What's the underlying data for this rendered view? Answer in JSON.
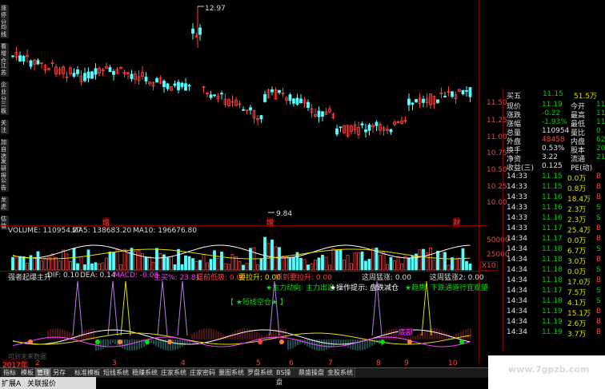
{
  "chart": {
    "price_high_label": "12.97",
    "price_low_label": "9.84",
    "price_axis": [
      "11.50",
      "11.25",
      "11.00",
      "10.75",
      "10.50",
      "10.25",
      "10.00"
    ],
    "vol_axis": [
      "50000",
      "25000",
      "X10"
    ],
    "volume_label": "VOLUME: 110954.27",
    "ma5_label": "MA5: 138683.20",
    "ma10_label": "MA10: 196676.80",
    "signal_a": "增",
    "signal_b": "增",
    "signal_c": "财",
    "ind_title": "强者起爆主升",
    "dif": "DIF: 0.10",
    "dea": "DEA: 0.14",
    "macd": "MACD: -0.08",
    "main_force": "主买%: 23.81",
    "ind_items": [
      "提前低吸: 0.00",
      "要拉升: 0.00",
      "抓到要拉升: 0.00"
    ],
    "trend_big_1": "这周猛涨: 0.00",
    "trend_big_2": "这周猛涨2: 0.00",
    "hint_1": "★主力动向: 主力出逃",
    "hint_2": "★操作提示: 盘跌减仓",
    "hint_3": "★趋势: 下跌通道行宜观望",
    "hint_4": "【 ★短线空仓★ 】",
    "bottom_tag": "底部",
    "hidden_text": "可到未来数据",
    "year": "2017年",
    "months": [
      "2",
      "3",
      "4",
      "5",
      "6",
      "7",
      "8",
      "9",
      "10"
    ]
  },
  "left_rail": [
    "涨停分析",
    "均线",
    "看增仓",
    "江苏",
    "企业分析",
    "三板",
    "关注",
    "加自选",
    "发研报",
    "公告",
    "龙虎",
    "估值"
  ],
  "quote": {
    "title": "买五",
    "buy5": [
      "11.15",
      "51.5万"
    ],
    "rows": [
      {
        "l": "现价",
        "v": "11.19",
        "l2": "今开",
        "v2": "11"
      },
      {
        "l": "涨跌",
        "v": "-0.22",
        "l2": "最高",
        "v2": "11"
      },
      {
        "l": "涨幅",
        "v": "-1.93%",
        "l2": "最低",
        "v2": "11"
      },
      {
        "l": "总量",
        "v": "110954",
        "l2": "量比",
        "v2": "0."
      },
      {
        "l": "外盘",
        "v": "48458",
        "l2": "内盘",
        "v2": "62"
      },
      {
        "l": "换手",
        "v": "0.53%",
        "l2": "股本",
        "v2": "20"
      },
      {
        "l": "净资",
        "v": "3.22",
        "l2": "流通",
        "v2": "21"
      },
      {
        "l": "收益(三)",
        "v": "0.125",
        "l2": "PE(动)",
        "v2": ""
      }
    ],
    "ticks": [
      {
        "t": "14:33",
        "p": "11.15",
        "q": "0.0万",
        "s": "B"
      },
      {
        "t": "14:33",
        "p": "11.15",
        "q": "0.8万",
        "s": "B"
      },
      {
        "t": "14:33",
        "p": "11.16",
        "q": "18.4万",
        "s": "B"
      },
      {
        "t": "14:33",
        "p": "11.16",
        "q": "2.3万",
        "s": "S"
      },
      {
        "t": "14:33",
        "p": "11.16",
        "q": "2.3万",
        "s": "S"
      },
      {
        "t": "14:33",
        "p": "11.17",
        "q": "25.4万",
        "s": "B"
      },
      {
        "t": "14:34",
        "p": "11.17",
        "q": "0.0万",
        "s": "B"
      },
      {
        "t": "14:34",
        "p": "11.18",
        "q": "6.7万",
        "s": "S"
      },
      {
        "t": "14:34",
        "p": "11.18",
        "q": "3.0万",
        "s": "B"
      },
      {
        "t": "14:34",
        "p": "11.18",
        "q": "0.0万",
        "s": "S"
      },
      {
        "t": "14:34",
        "p": "11.18",
        "q": "17.0万",
        "s": "B"
      },
      {
        "t": "14:34",
        "p": "11.17",
        "q": "7.5万",
        "s": "S"
      },
      {
        "t": "14:34",
        "p": "11.18",
        "q": "4.1万",
        "s": "S"
      },
      {
        "t": "14:34",
        "p": "11.19",
        "q": "15.1万",
        "s": "B"
      },
      {
        "t": "14:34",
        "p": "11.19",
        "q": "2.6万",
        "s": "B"
      },
      {
        "t": "14:34",
        "p": "11.19",
        "q": "3.7万",
        "s": "B"
      }
    ]
  },
  "tabs": [
    "指标",
    "模板",
    "管理",
    "另存为",
    "标准模板",
    "短线系统",
    "稳赚系统",
    "庄家系统",
    "庄家密码",
    "量图系统",
    "罗盘系统",
    "BS操盘",
    "鼎盛操盘",
    "金股系统"
  ],
  "status": [
    "扩展A",
    "关联报价"
  ],
  "watermark": "www.7gpzb.com"
}
